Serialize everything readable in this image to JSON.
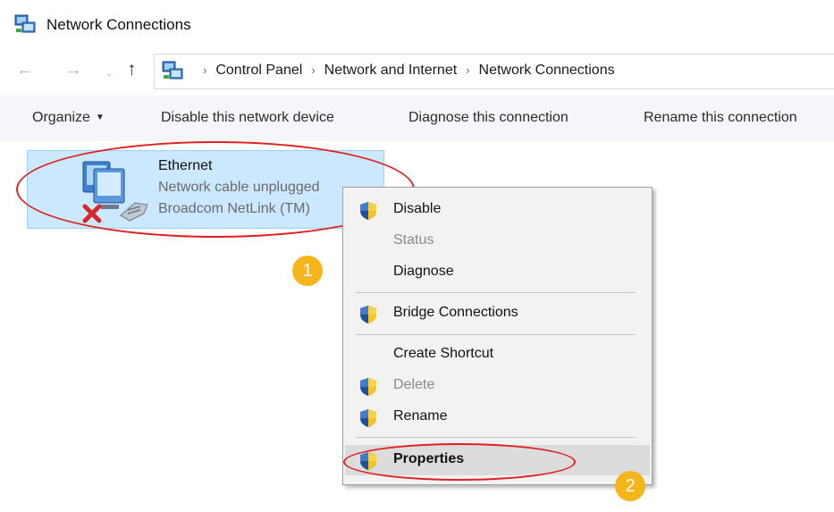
{
  "window": {
    "title": "Network Connections"
  },
  "address": {
    "breadcrumbs": [
      "Control Panel",
      "Network and Internet",
      "Network Connections"
    ],
    "separator": "›",
    "nav": {
      "back": "←",
      "forward": "→",
      "recent": "⌄",
      "up": "↑"
    }
  },
  "toolbar": {
    "organize": "Organize",
    "caret": "▼",
    "disable": "Disable this network device",
    "diagnose": "Diagnose this connection",
    "rename": "Rename this connection"
  },
  "connection": {
    "name": "Ethernet",
    "status": "Network cable unplugged",
    "adapter": "Broadcom NetLink (TM)"
  },
  "context_menu": {
    "items": [
      {
        "label": "Disable",
        "shield": true,
        "enabled": true,
        "bold": false
      },
      {
        "label": "Status",
        "shield": false,
        "enabled": false,
        "bold": false
      },
      {
        "label": "Diagnose",
        "shield": false,
        "enabled": true,
        "bold": false
      },
      {
        "label": "Bridge Connections",
        "shield": true,
        "enabled": true,
        "bold": false
      },
      {
        "label": "Create Shortcut",
        "shield": false,
        "enabled": true,
        "bold": false
      },
      {
        "label": "Delete",
        "shield": true,
        "enabled": false,
        "bold": false
      },
      {
        "label": "Rename",
        "shield": true,
        "enabled": true,
        "bold": false
      },
      {
        "label": "Properties",
        "shield": true,
        "enabled": true,
        "bold": true,
        "highlighted": true
      }
    ]
  },
  "annotations": {
    "step1": "1",
    "step2": "2",
    "ellipse_color": "#e02020",
    "badge_color": "#f6b61b"
  },
  "colors": {
    "selection_bg": "#cce8ff",
    "selection_border": "#99d1ff",
    "toolbar_bg": "#f4f6f9",
    "menu_bg": "#f2f2f2"
  }
}
